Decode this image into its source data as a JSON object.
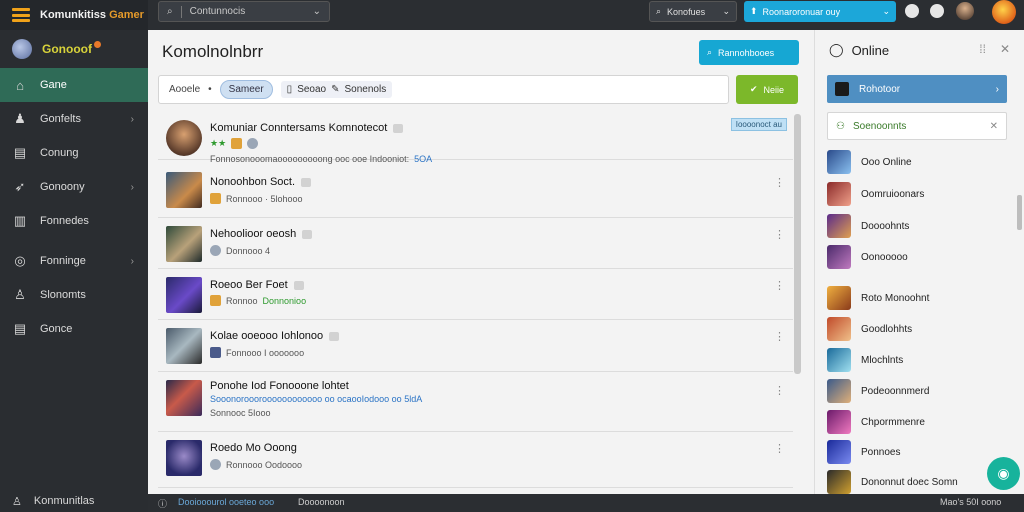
{
  "app": {
    "brand_prefix": "Komunkitiss",
    "brand_suffix": "Gamer",
    "logo_text": "Gonooof"
  },
  "sidebar": {
    "items": [
      {
        "label": "Gane",
        "icon": "home-icon",
        "active": true
      },
      {
        "label": "Gonfelts",
        "icon": "user-icon",
        "chevron": true
      },
      {
        "label": "Conung",
        "icon": "list-icon"
      },
      {
        "label": "Gonoony",
        "icon": "rocket-icon",
        "chevron": true
      },
      {
        "label": "Fonnedes",
        "icon": "grid-icon"
      },
      {
        "label": "Fonninge",
        "icon": "circle-icon",
        "chevron": true
      },
      {
        "label": "Slonomts",
        "icon": "person-icon"
      },
      {
        "label": "Gonce",
        "icon": "list-icon"
      }
    ],
    "footer_label": "Konmunitlas"
  },
  "topbar": {
    "search_placeholder": "Contunnocis",
    "dropdown_label": "Konofues",
    "cta_label": "Roonaroronuar ouy"
  },
  "main": {
    "title": "Komolnolnbrr",
    "action_button": "Rannohbooes",
    "filter": {
      "label": "Aooele",
      "chip_active": "Sameer",
      "chip2_label": "Seoao",
      "chip3_label": "Sonenols"
    },
    "go_button": "Neiie",
    "rows": [
      {
        "title": "Komuniar Conntersams Komnotecot",
        "rating_line": "Fonnosonooomaooooooooong ooc ooe Indooniot:",
        "rating_suffix": "5OA",
        "badge": "Ioooonoct au",
        "stars": "★★"
      },
      {
        "title": "Nonoohbon Soct.",
        "meta": "Ronnooo · 5lohooo"
      },
      {
        "title": "Nehoolioor oeosh",
        "meta": "Donnooo 4"
      },
      {
        "title": "Roeoo Ber Foet",
        "meta": "Ronnoo",
        "meta_green": "Donnonioo"
      },
      {
        "title": "Kolae ooeooo Iohlonoo",
        "meta": "Fonnooo I ooooooo"
      },
      {
        "title": "Ponohe Iod Fonooone lohtet",
        "long_meta": "Sooonoroooroooooooooooo oo ocaooIodooo oo",
        "long_suffix": "5ldA",
        "meta": "Sonnooc 5Iooo"
      },
      {
        "title": "Roedo Mo Ooong",
        "meta": "Ronnooo Oodoooo"
      }
    ],
    "status_left": "Dooiooourol ooeteo ooo",
    "status_left2": "Doooonoon",
    "status_right": "Mao's 50I oono"
  },
  "right_panel": {
    "title": "Online",
    "selected_user": "Rohotoor",
    "filter_label": "Soenoonnts",
    "users": [
      "Ooo Online",
      "Oomruioonars",
      "Doooohnts",
      "Oonooooo",
      "Roto Monoohnt",
      "Goodlohhts",
      "Mlochlnts",
      "Podeoonnmerd",
      "Chpormmenre",
      "Ponnoes",
      "Dononnut doec Somn"
    ]
  },
  "colors": {
    "sidebar_active": "#2f6b57",
    "accent_blue": "#16a7d3",
    "accent_green": "#7cb82a",
    "fab": "#17b39c"
  }
}
